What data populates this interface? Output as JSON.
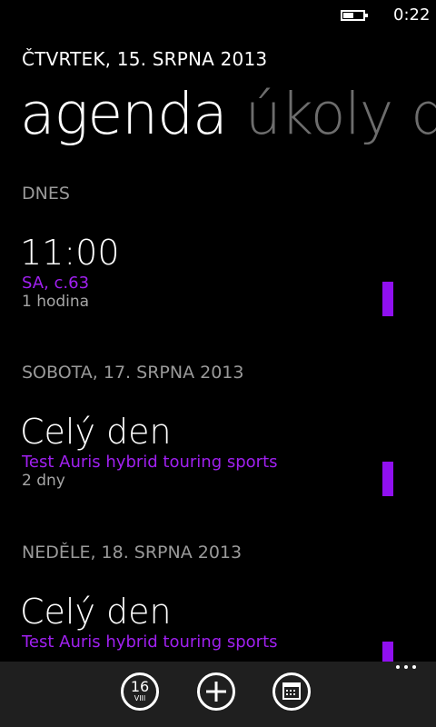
{
  "status": {
    "time": "0:22",
    "battery_level": 0.5
  },
  "date_header": "ČTVRTEK, 15. SRPNA 2013",
  "pivots": [
    {
      "label": "agenda",
      "active": true
    },
    {
      "label": "úkoly",
      "active": false
    },
    {
      "label": "d",
      "active": false
    }
  ],
  "sections": [
    {
      "header": "DNES",
      "event": {
        "time": "11:00",
        "title": "SA, c.63",
        "duration": "1 hodina"
      }
    },
    {
      "header": "SOBOTA, 17. SRPNA 2013",
      "event": {
        "time": "Celý den",
        "title": "Test Auris hybrid touring sports",
        "duration": "2 dny"
      }
    },
    {
      "header": "NEDĚLE, 18. SRPNA 2013",
      "event": {
        "time": "Celý den",
        "title": "Test Auris hybrid touring sports"
      }
    }
  ],
  "app_bar": {
    "today_day": "16",
    "today_month": "VIII"
  },
  "colors": {
    "accent": "#a020f0",
    "background": "#000000",
    "app_bar": "#1f1f1f"
  }
}
